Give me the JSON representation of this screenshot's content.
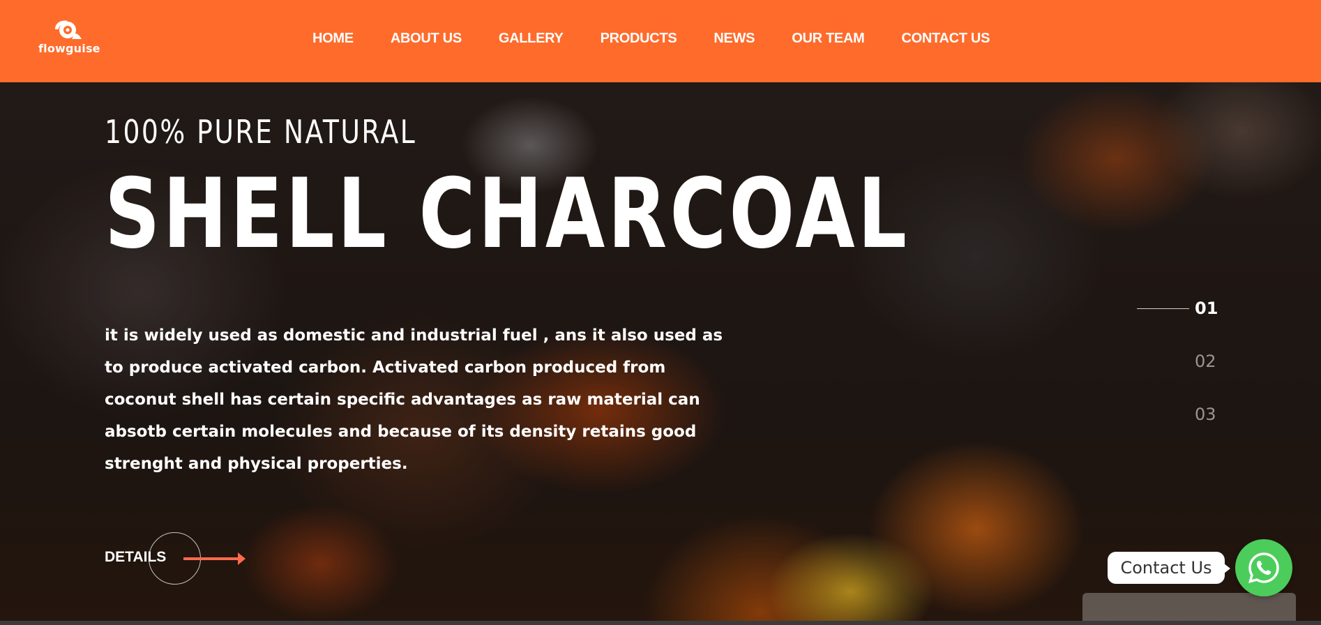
{
  "brand": {
    "name": "flowguise",
    "logo_icon": "flowguise-logo-icon"
  },
  "nav": {
    "items": [
      {
        "label": "HOME"
      },
      {
        "label": "ABOUT US"
      },
      {
        "label": "GALLERY"
      },
      {
        "label": "PRODUCTS"
      },
      {
        "label": "NEWS"
      },
      {
        "label": "OUR TEAM"
      },
      {
        "label": "CONTACT US"
      }
    ]
  },
  "hero": {
    "kicker": "100% PURE NATURAL",
    "headline": "SHELL CHARCOAL",
    "description": "it is widely used as domestic and industrial fuel , ans it also used as to produce activated carbon. Activated carbon produced from coconut shell has certain specific advantages as raw material can absotb certain molecules and because of its density retains good strenght and physical properties.",
    "cta_label": "DETAILS",
    "cta_icon": "arrow-right-icon"
  },
  "pager": {
    "items": [
      "01",
      "02",
      "03"
    ],
    "active_index": 0
  },
  "contact_widget": {
    "label": "Contact Us",
    "icon": "whatsapp-icon"
  },
  "colors": {
    "header_bg": "#ff6b2b",
    "accent_arrow": "#ff6b4a",
    "whatsapp_green": "#4ccd5b",
    "text": "#ffffff"
  }
}
